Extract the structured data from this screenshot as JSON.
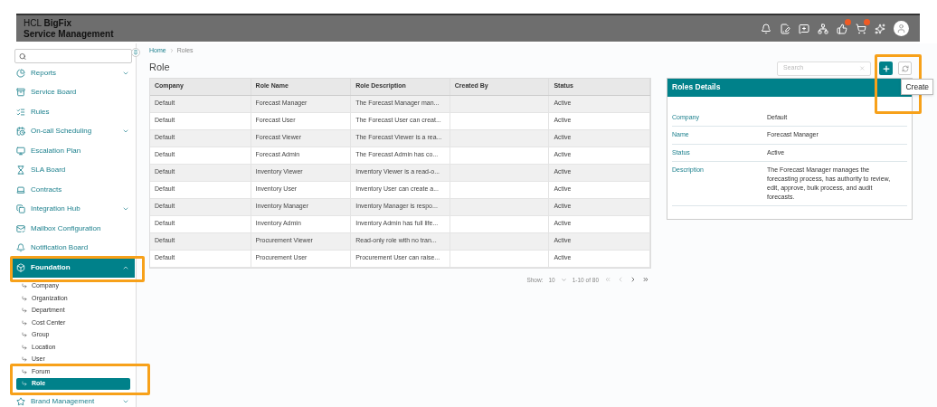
{
  "header": {
    "brand_line_1": "HCL **BigFix**",
    "brand_line_2": "Service Management"
  },
  "sidebar": {
    "items": [
      {
        "label": "Reports",
        "expanded": false,
        "selected": false
      },
      {
        "label": "Service Board",
        "selected": false
      },
      {
        "label": "Rules",
        "selected": false
      },
      {
        "label": "On-call Scheduling",
        "expanded": false,
        "selected": false
      },
      {
        "label": "Escalation Plan",
        "selected": false
      },
      {
        "label": "SLA Board",
        "selected": false
      },
      {
        "label": "Contracts",
        "selected": false
      },
      {
        "label": "Integration Hub",
        "expanded": false,
        "selected": false
      },
      {
        "label": "Mailbox Configuration",
        "selected": false
      },
      {
        "label": "Notification Board",
        "selected": false
      },
      {
        "label": "Foundation",
        "expanded": true,
        "selected": true,
        "children": [
          {
            "label": "Company",
            "selected": false
          },
          {
            "label": "Organization",
            "selected": false
          },
          {
            "label": "Department",
            "selected": false
          },
          {
            "label": "Cost Center",
            "selected": false
          },
          {
            "label": "Group",
            "selected": false
          },
          {
            "label": "Location",
            "selected": false
          },
          {
            "label": "User",
            "selected": false
          },
          {
            "label": "Forum",
            "selected": false
          },
          {
            "label": "Role",
            "selected": true
          }
        ]
      },
      {
        "label": "Brand Management",
        "expanded": false,
        "selected": false
      }
    ]
  },
  "breadcrumb": [
    "Home",
    "Roles"
  ],
  "page_title": "Role",
  "search": {
    "placeholder": "Search"
  },
  "tooltip": "Create",
  "table": {
    "columns": [
      "Company",
      "Role Name",
      "Role Description",
      "Created By",
      "Status"
    ],
    "rows": [
      [
        "Default",
        "Forecast Manager",
        "The Forecast Manager man...",
        "",
        "Active"
      ],
      [
        "Default",
        "Forecast User",
        "The Forecast User can creat...",
        "",
        "Active"
      ],
      [
        "Default",
        "Forecast Viewer",
        "The Forecast Viewer is a rea...",
        "",
        "Active"
      ],
      [
        "Default",
        "Forecast Admin",
        "The Forecast Admin has co...",
        "",
        "Active"
      ],
      [
        "Default",
        "Inventory Viewer",
        "Inventory Viewer is a read-o...",
        "",
        "Active"
      ],
      [
        "Default",
        "Inventory User",
        "Inventory User can create a...",
        "",
        "Active"
      ],
      [
        "Default",
        "Inventory Manager",
        "Inventory Manager is respo...",
        "",
        "Active"
      ],
      [
        "Default",
        "Inventory Admin",
        "Inventory Admin has full life...",
        "",
        "Active"
      ],
      [
        "Default",
        "Procurement Viewer",
        "Read-only role with no tran...",
        "",
        "Active"
      ],
      [
        "Default",
        "Procurement User",
        "Procurement User can raise...",
        "",
        "Active"
      ]
    ]
  },
  "pagination": {
    "show_label": "Show:",
    "page_size": "10",
    "range": "1-10 of 80"
  },
  "details": {
    "title": "Roles Details",
    "fields": [
      {
        "label": "Company",
        "value": "Default"
      },
      {
        "label": "Name",
        "value": "Forecast Manager"
      },
      {
        "label": "Status",
        "value": "Active"
      },
      {
        "label": "Description",
        "value": "The Forecast Manager manages the forecasting process, has authority to review, edit, approve, bulk process, and audit forecasts."
      }
    ]
  }
}
